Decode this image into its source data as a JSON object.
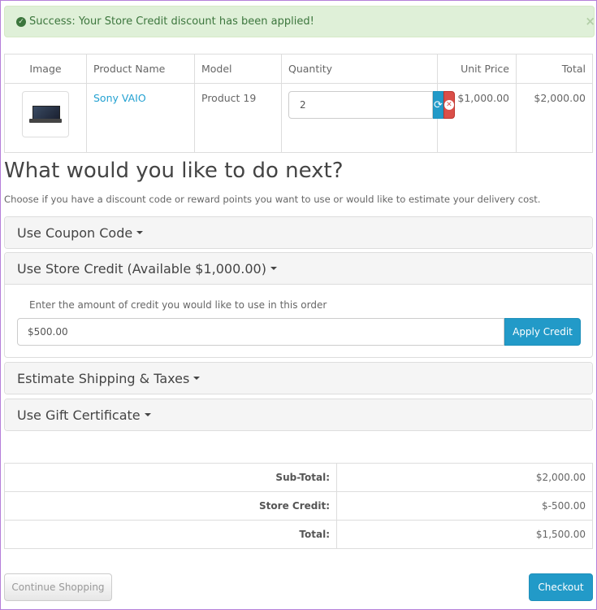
{
  "alert": {
    "message": "Success: Your Store Credit discount has been applied!",
    "close": "×"
  },
  "cart": {
    "headers": {
      "image": "Image",
      "name": "Product Name",
      "model": "Model",
      "quantity": "Quantity",
      "unit_price": "Unit Price",
      "total": "Total"
    },
    "rows": [
      {
        "name": "Sony VAIO",
        "model": "Product 19",
        "quantity": "2",
        "unit_price": "$1,000.00",
        "total": "$2,000.00"
      }
    ]
  },
  "heading": "What would you like to do next?",
  "intro": "Choose if you have a discount code or reward points you want to use or would like to estimate your delivery cost.",
  "panels": {
    "coupon": "Use Coupon Code",
    "credit": "Use Store Credit (Available $1,000.00)",
    "credit_label": "Enter the amount of credit you would like to use in this order",
    "credit_value": "$500.00",
    "apply_label": "Apply Credit",
    "shipping": "Estimate Shipping & Taxes",
    "gift": "Use Gift Certificate"
  },
  "totals": [
    {
      "label": "Sub-Total:",
      "value": "$2,000.00"
    },
    {
      "label": "Store Credit:",
      "value": "$-500.00"
    },
    {
      "label": "Total:",
      "value": "$1,500.00"
    }
  ],
  "actions": {
    "continue": "Continue Shopping",
    "checkout": "Checkout"
  },
  "colors": {
    "primary": "#229ac8",
    "danger": "#da4f49",
    "success_bg": "#dff0d8",
    "success_text": "#3c763d"
  }
}
